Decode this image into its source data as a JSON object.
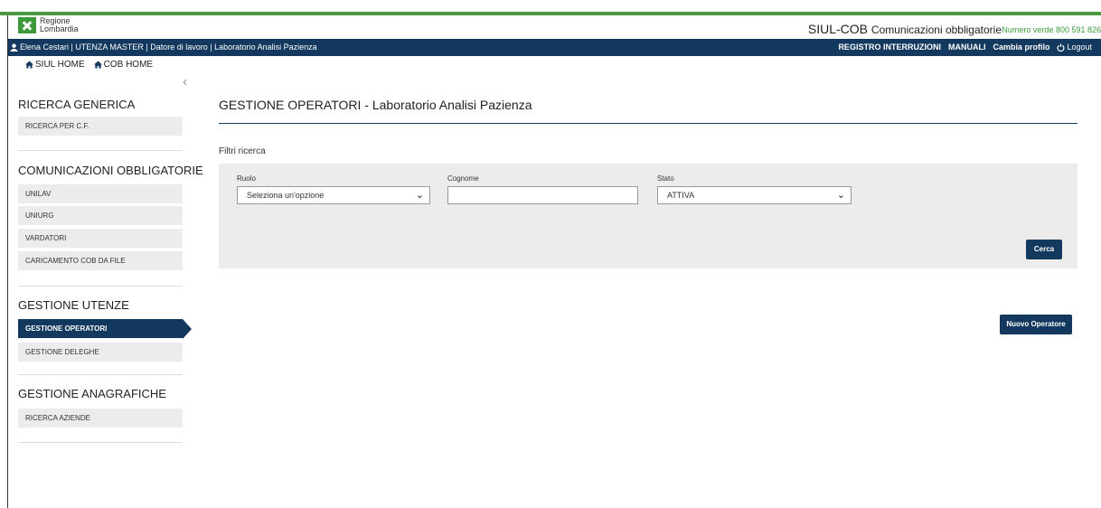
{
  "header": {
    "logo_line1": "Regione",
    "logo_line2": "Lombardia",
    "app_title": "SIUL-COB",
    "app_subtitle": "Comunicazioni obbligatorie",
    "phone": "Numero verde 800 591 826"
  },
  "navbar": {
    "user_info": "Elena Cestari | UTENZA MASTER | Datore di lavoro | Laboratorio Analisi Pazienza",
    "links": [
      "REGISTRO INTERRUZIONI",
      "MANUALI",
      "Cambia profilo",
      "Logout"
    ]
  },
  "breadcrumbs": [
    "SIUL HOME",
    "COB HOME"
  ],
  "sidebar": {
    "sections": [
      {
        "title": "RICERCA GENERICA",
        "items": [
          "RICERCA PER C.F."
        ]
      },
      {
        "title": "COMUNICAZIONI OBBLIGATORIE",
        "items": [
          "UNILAV",
          "UNIURG",
          "VARDATORI",
          "CARICAMENTO COB DA FILE"
        ]
      },
      {
        "title": "GESTIONE UTENZE",
        "items": [
          "GESTIONE OPERATORI",
          "GESTIONE DELEGHE"
        ]
      },
      {
        "title": "GESTIONE ANAGRAFICHE",
        "items": [
          "RICERCA AZIENDE"
        ]
      }
    ]
  },
  "main": {
    "title": "GESTIONE OPERATORI - Laboratorio Analisi Pazienza",
    "filters_label": "Filtri ricerca",
    "filters": {
      "ruolo_label": "Ruolo",
      "ruolo_value": "Seleziona un'opzione",
      "cognome_label": "Cognome",
      "cognome_value": "",
      "stato_label": "Stato",
      "stato_value": "ATTIVA"
    },
    "search_button": "Cerca",
    "new_button": "Nuovo Operatore"
  },
  "colors": {
    "primary": "#13395e",
    "brand_green": "#4a9a3f",
    "panel": "#ececec"
  }
}
